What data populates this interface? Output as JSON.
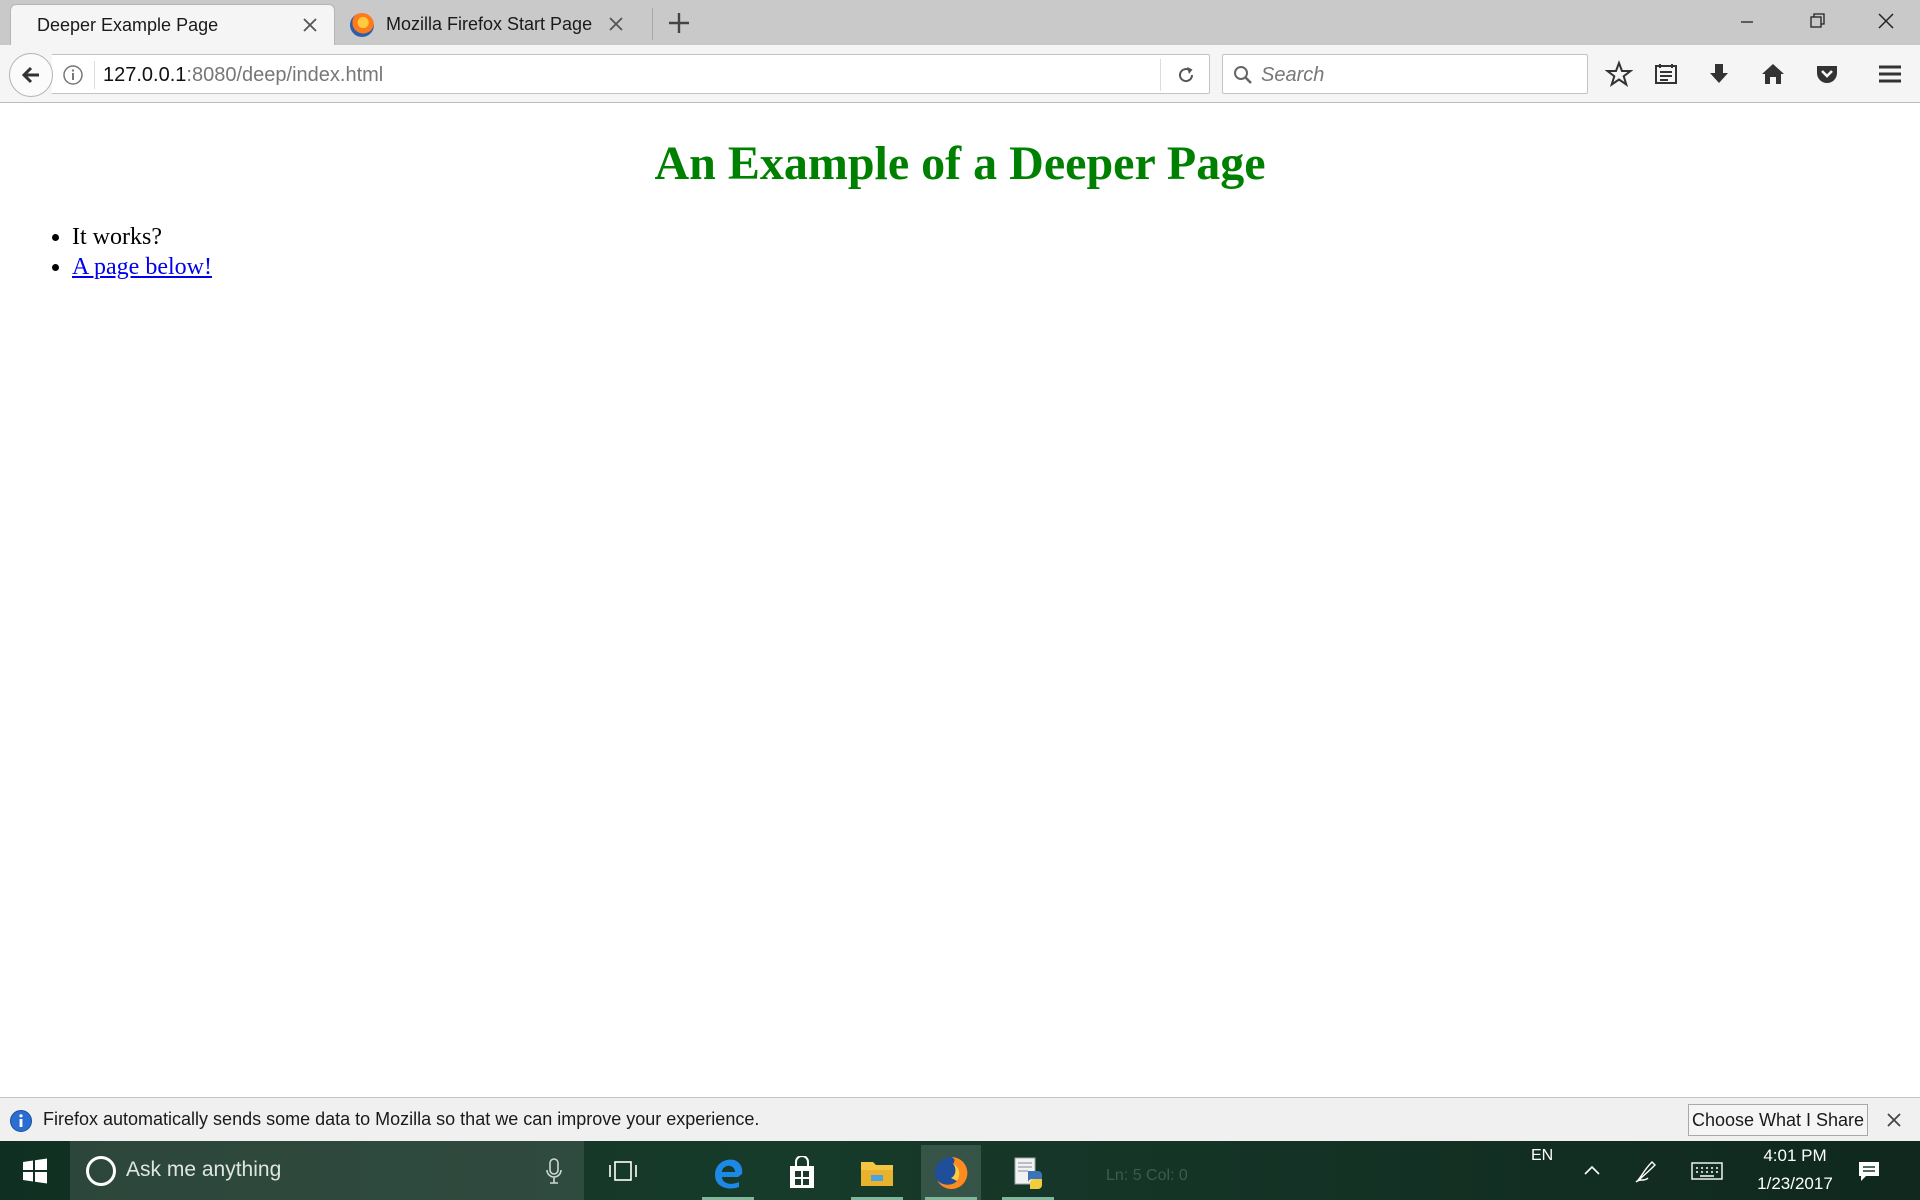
{
  "browser": {
    "tabs": [
      {
        "label": "Deeper Example Page",
        "active": true
      },
      {
        "label": "Mozilla Firefox Start Page",
        "active": false
      }
    ],
    "url": {
      "host": "127.0.0.1",
      "rest": ":8080/deep/index.html"
    },
    "search_placeholder": "Search"
  },
  "page": {
    "heading": "An Example of a Deeper Page",
    "list_items": [
      {
        "text": "It works?",
        "is_link": false
      },
      {
        "text": "A page below!",
        "is_link": true
      }
    ],
    "heading_color": "#008000",
    "link_color": "#0000ee"
  },
  "notification": {
    "message": "Firefox automatically sends some data to Mozilla so that we can improve your experience.",
    "button_label": "Choose What I Share"
  },
  "taskbar": {
    "search_placeholder": "Ask me anything",
    "background_app_status": "Ln: 5   Col: 0",
    "language": "EN",
    "time": "4:01 PM",
    "date": "1/23/2017",
    "apps": [
      "edge-icon",
      "store-icon",
      "file-explorer-icon",
      "firefox-icon",
      "python-editor-icon"
    ]
  }
}
